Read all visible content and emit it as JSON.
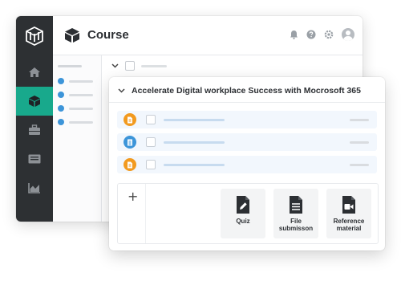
{
  "header": {
    "title": "Course"
  },
  "module": {
    "title": "Accelerate Digital workplace Success with Mocrosoft 365"
  },
  "content_types": [
    {
      "label": "Quiz"
    },
    {
      "label": "File\nsubmisson"
    },
    {
      "label": "Reference\nmaterial"
    }
  ],
  "lesson_icons": [
    "document-icon",
    "document-icon",
    "document-icon"
  ],
  "colors": {
    "rail": "#2d3033",
    "rail_active": "#18a98c",
    "accent_blue": "#3d95d9",
    "accent_orange": "#f29a1f",
    "row_bg": "#f2f7fd"
  },
  "icons": {
    "rail": [
      "logo-icon",
      "home-icon",
      "course-box-icon",
      "briefcase-icon",
      "id-card-icon",
      "chart-icon"
    ],
    "topbar": [
      "bell-icon",
      "help-icon",
      "settings-icon",
      "user-avatar-icon"
    ],
    "tiles": [
      "quiz-icon",
      "file-submission-icon",
      "video-icon"
    ]
  }
}
